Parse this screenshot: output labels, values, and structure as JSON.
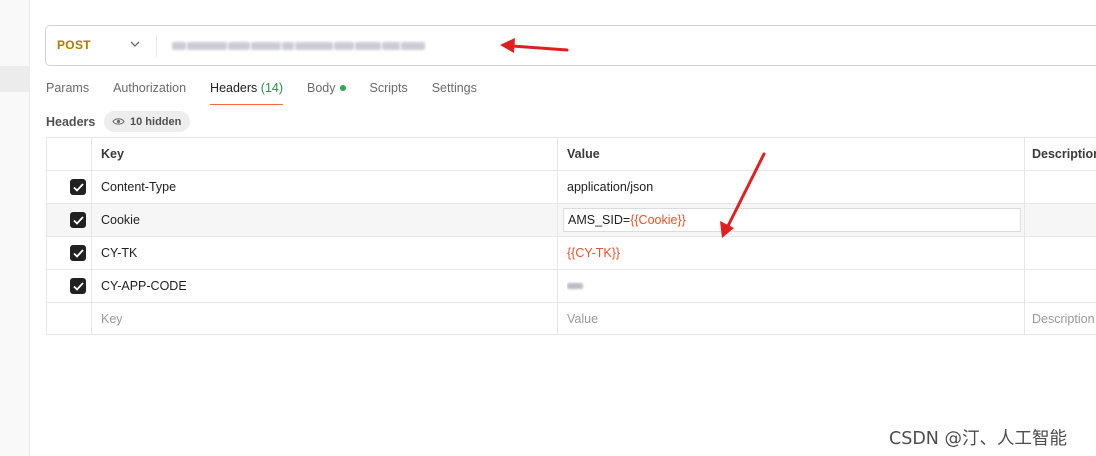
{
  "request": {
    "method": "POST",
    "url": ""
  },
  "tabs": [
    {
      "label": "Params"
    },
    {
      "label": "Authorization"
    },
    {
      "label": "Headers",
      "count": "(14)",
      "active": true
    },
    {
      "label": "Body"
    },
    {
      "label": "Scripts"
    },
    {
      "label": "Settings"
    }
  ],
  "headers_section": {
    "label": "Headers",
    "hidden_chip": "10 hidden"
  },
  "table": {
    "columns": {
      "key": "Key",
      "value": "Value",
      "description": "Description"
    },
    "rows": [
      {
        "checked": true,
        "key": "Content-Type",
        "value": "application/json"
      },
      {
        "checked": true,
        "key": "Cookie",
        "value_prefix": "AMS_SID=",
        "value_var": "{{Cookie}}"
      },
      {
        "checked": true,
        "key": "CY-TK",
        "value_var": "{{CY-TK}}"
      },
      {
        "checked": true,
        "key": "CY-APP-CODE",
        "value": ""
      }
    ],
    "placeholder": {
      "key": "Key",
      "value": "Value",
      "description": "Description"
    }
  },
  "watermark": "CSDN @汀、人工智能",
  "colors": {
    "accent": "#ff6c37",
    "method": "#ad7a03",
    "variable": "#e8542b",
    "annotation": "#e02020"
  }
}
